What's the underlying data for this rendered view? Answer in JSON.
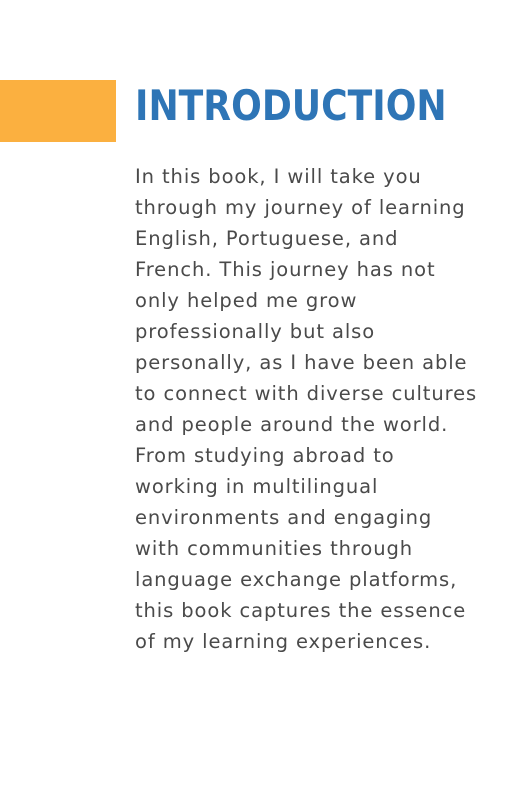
{
  "page": {
    "title": "INTRODUCTION",
    "body": "In this book, I will take you through my journey of learning English, Portuguese, and French. This journey has not only helped me grow professionally but also personally, as I have been able to connect with diverse cultures and people around the world. From studying abroad to working in multilingual environments and engaging with communities through language exchange platforms, this book captures the essence of my learning experiences."
  },
  "colors": {
    "accent": "#FBB040",
    "title": "#2E75B6",
    "text": "#4a4a4a",
    "background": "#ffffff"
  }
}
